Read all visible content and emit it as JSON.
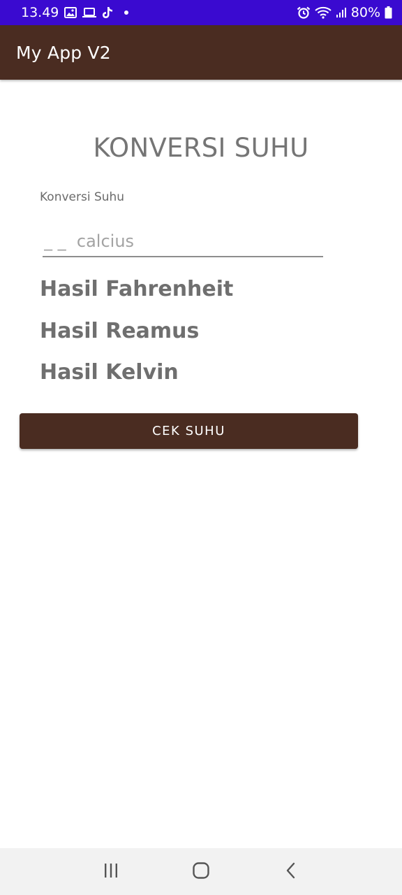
{
  "status_bar": {
    "time": "13.49",
    "battery": "80%",
    "background": "#3a0ad0"
  },
  "app_bar": {
    "title": "My App V2",
    "color": "#4a2c21"
  },
  "main": {
    "heading": "KONVERSI SUHU",
    "field_label": "Konversi Suhu",
    "input_placeholder": "_ _  calcius",
    "input_value": "",
    "results": {
      "fahrenheit": "Hasil Fahrenheit",
      "reamus": "Hasil Reamus",
      "kelvin": "Hasil Kelvin"
    },
    "button_label": "CEK SUHU"
  },
  "nav_bar": {
    "icons": [
      "recent-apps-icon",
      "home-icon",
      "back-icon"
    ]
  }
}
